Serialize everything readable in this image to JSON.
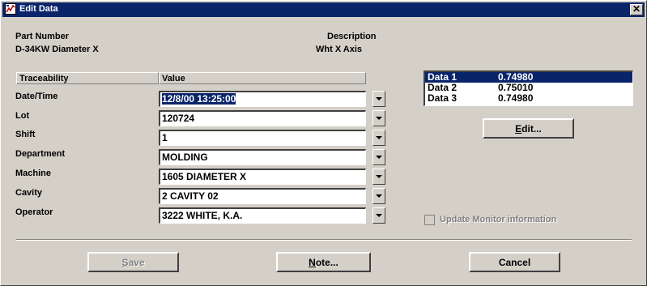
{
  "window": {
    "title": "Edit Data",
    "close_glyph": "✕"
  },
  "part": {
    "label": "Part Number",
    "value": "D-34KW Diameter X"
  },
  "description": {
    "label": "Description",
    "value": "Wht X Axis"
  },
  "grid": {
    "col_traceability": "Traceability",
    "col_value": "Value"
  },
  "fields": [
    {
      "label": "Date/Time",
      "value": "12/8/00 13:25:00"
    },
    {
      "label": "Lot",
      "value": "120724"
    },
    {
      "label": "Shift",
      "value": "1"
    },
    {
      "label": "Department",
      "value": "MOLDING"
    },
    {
      "label": "Machine",
      "value": "1605 DIAMETER X"
    },
    {
      "label": "Cavity",
      "value": "2 CAVITY 02"
    },
    {
      "label": "Operator",
      "value": "3222 WHITE, K.A."
    }
  ],
  "data_list": [
    {
      "name": "Data 1",
      "value": "0.74980",
      "selected": true
    },
    {
      "name": "Data 2",
      "value": "0.75010",
      "selected": false
    },
    {
      "name": "Data 3",
      "value": "0.74980",
      "selected": false
    }
  ],
  "buttons": {
    "edit_pre": "E",
    "edit_rest": "dit...",
    "save_pre": "S",
    "save_rest": "ave",
    "note_pre": "N",
    "note_rest": "ote...",
    "cancel": "Cancel"
  },
  "checkbox": {
    "label": "Update Monitor information",
    "checked": false,
    "enabled": false
  },
  "colors": {
    "face": "#d4d0c8",
    "titlebar": "#0a246a",
    "selection": "#0a246a"
  }
}
